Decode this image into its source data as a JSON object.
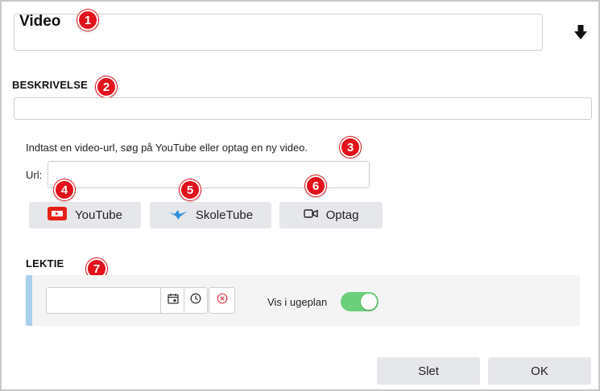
{
  "title": {
    "value": "Video"
  },
  "description": {
    "label": "BESKRIVELSE",
    "value": ""
  },
  "url_section": {
    "hint": "Indtast en video-url, søg på YouTube eller optag en ny video.",
    "url_label": "Url:",
    "url_value": ""
  },
  "buttons": {
    "youtube": "YouTube",
    "skoletube": "SkoleTube",
    "record": "Optag"
  },
  "lektie": {
    "label": "LEKTIE",
    "date_value": "",
    "toggle_label": "Vis i ugeplan",
    "toggle_on": true
  },
  "footer": {
    "delete": "Slet",
    "ok": "OK"
  },
  "badges": [
    "1",
    "2",
    "3",
    "4",
    "5",
    "6",
    "7"
  ],
  "colors": {
    "badge": "#e2111b",
    "button_bg": "#e6e7ea",
    "toggle_on": "#6ccf7b",
    "lektie_accent": "#a9d0eb",
    "youtube_red": "#e62117",
    "skoletube_blue": "#2f8fd8"
  }
}
